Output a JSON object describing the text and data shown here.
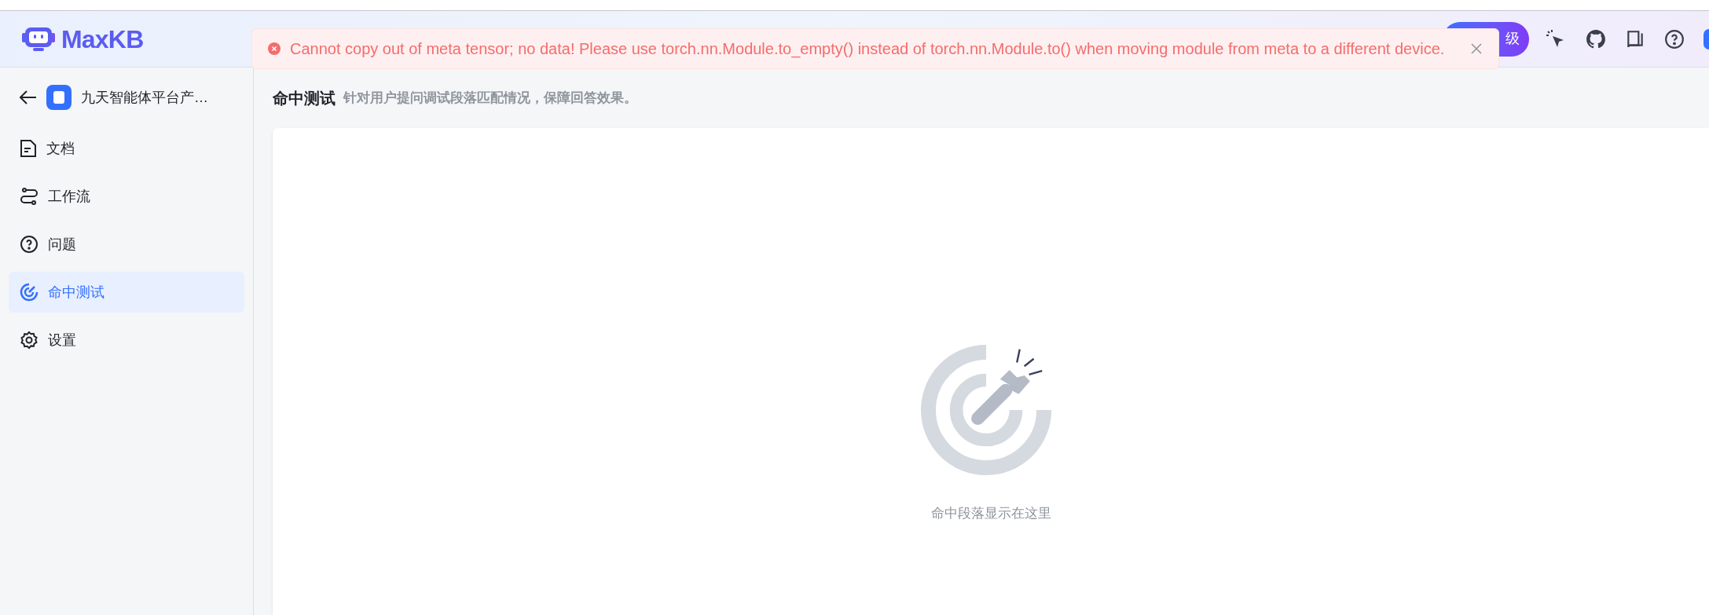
{
  "header": {
    "logo_text": "MaxKB",
    "upgrade_button": "级"
  },
  "toast": {
    "kind": "error",
    "message": "Cannot copy out of meta tensor; no data! Please use torch.nn.Module.to_empty() instead of torch.nn.Module.to() when moving module from meta to a different device."
  },
  "sidebar": {
    "title": "九天智能体平台产…",
    "items": [
      {
        "label": "文档",
        "kind": "document",
        "selected": false
      },
      {
        "label": "工作流",
        "kind": "workflow",
        "selected": false
      },
      {
        "label": "问题",
        "kind": "question",
        "selected": false
      },
      {
        "label": "命中测试",
        "kind": "target",
        "selected": true
      },
      {
        "label": "设置",
        "kind": "settings",
        "selected": false
      }
    ]
  },
  "main": {
    "title": "命中测试",
    "subtitle": "针对用户提问调试段落匹配情况，保障回答效果。",
    "empty_text": "命中段落显示在这里"
  }
}
